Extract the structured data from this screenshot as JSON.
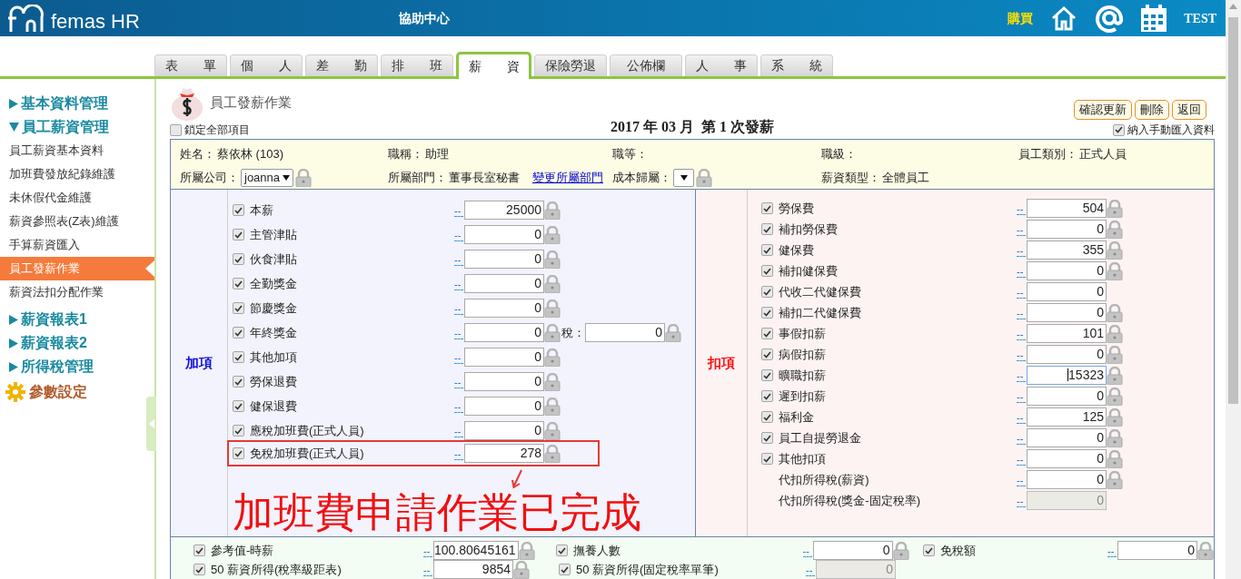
{
  "header": {
    "logo_text": "femas HR",
    "help_link": "協助中心",
    "buy_link": "購買",
    "user": "TEST"
  },
  "tabs": [
    {
      "label": "表　　單",
      "selected": false
    },
    {
      "label": "個　　人",
      "selected": false
    },
    {
      "label": "差　　勤",
      "selected": false
    },
    {
      "label": "排　　班",
      "selected": false
    },
    {
      "label": "薪　　資",
      "selected": true
    },
    {
      "label": "保險勞退",
      "selected": false
    },
    {
      "label": "公佈欄",
      "selected": false
    },
    {
      "label": "人　　事",
      "selected": false
    },
    {
      "label": "系　　統",
      "selected": false
    }
  ],
  "sidebar": {
    "items": [
      {
        "kind": "group",
        "label": "基本資料管理",
        "expanded": false
      },
      {
        "kind": "group",
        "label": "員工薪資管理",
        "expanded": true,
        "children": [
          {
            "label": "員工薪資基本資料",
            "selected": false
          },
          {
            "label": "加班費發放紀錄維護",
            "selected": false
          },
          {
            "label": "未休假代金維護",
            "selected": false
          },
          {
            "label": "薪資參照表(Z表)維護",
            "selected": false
          },
          {
            "label": "手算薪資匯入",
            "selected": false
          },
          {
            "label": "員工發薪作業",
            "selected": true
          },
          {
            "label": "薪資法扣分配作業",
            "selected": false
          }
        ]
      },
      {
        "kind": "group",
        "label": "薪資報表1",
        "expanded": false
      },
      {
        "kind": "group",
        "label": "薪資報表2",
        "expanded": false
      },
      {
        "kind": "group",
        "label": "所得稅管理",
        "expanded": false
      },
      {
        "kind": "settings",
        "label": "參數設定"
      }
    ]
  },
  "page": {
    "title": "員工發薪作業",
    "buttons": [
      "確認更新",
      "刪除",
      "返回"
    ],
    "lock_all": {
      "label": "鎖定全部項目",
      "checked": false
    },
    "heading": "2017 年 03 月  第 1 次發薪",
    "include_manual": {
      "label": "納入手動匯入資料",
      "checked": true
    }
  },
  "info": {
    "name": {
      "label": "姓名：",
      "value": "蔡依林 (103)"
    },
    "job_title": {
      "label": "職稱：",
      "value": "助理"
    },
    "grade": {
      "label": "職等："
    },
    "level": {
      "label": "職級："
    },
    "category": {
      "label": "員工類別：",
      "value": "正式人員"
    },
    "company": {
      "label": "所屬公司：",
      "value": "joanna"
    },
    "department": {
      "label": "所屬部門：",
      "value": "董事長室秘書",
      "link": "變更所屬部門"
    },
    "cost": {
      "label": "成本歸屬："
    },
    "salary_type": {
      "label": "薪資類型：",
      "value": "全體員工"
    }
  },
  "additions": {
    "title": "加項",
    "rows": [
      {
        "kind": "check",
        "checked": true,
        "label": "本薪",
        "link": "--",
        "value": "25000",
        "lock": true,
        "highlighted": false
      },
      {
        "kind": "check",
        "checked": true,
        "label": "主管津貼",
        "link": "--",
        "value": "0",
        "lock": true,
        "highlighted": false
      },
      {
        "kind": "check",
        "checked": true,
        "label": "伙食津貼",
        "link": "--",
        "value": "0",
        "lock": true,
        "highlighted": false
      },
      {
        "kind": "check",
        "checked": true,
        "label": "全勤獎金",
        "link": "--",
        "value": "0",
        "lock": true,
        "highlighted": false
      },
      {
        "kind": "check",
        "checked": true,
        "label": "節慶獎金",
        "link": "--",
        "value": "0",
        "lock": true,
        "highlighted": false
      },
      {
        "kind": "check",
        "checked": true,
        "label": "年終獎金",
        "link": "--",
        "value": "0",
        "lock": true,
        "highlighted": false,
        "tax_label": "稅：",
        "tax_value": "0"
      },
      {
        "kind": "check",
        "checked": true,
        "label": "其他加項",
        "link": "--",
        "value": "0",
        "lock": true,
        "highlighted": false
      },
      {
        "kind": "check",
        "checked": true,
        "label": "勞保退費",
        "link": "--",
        "value": "0",
        "lock": true,
        "highlighted": false
      },
      {
        "kind": "check",
        "checked": true,
        "label": "健保退費",
        "link": "--",
        "value": "0",
        "lock": true,
        "highlighted": false
      },
      {
        "kind": "check",
        "checked": true,
        "label": "應稅加班費(正式人員)",
        "link": "--",
        "value": "0",
        "lock": true,
        "highlighted": false
      },
      {
        "kind": "check",
        "checked": true,
        "label": "免稅加班費(正式人員)",
        "link": "--",
        "value": "278",
        "lock": true,
        "highlighted": true
      }
    ],
    "annotation": "加班費申請作業已完成"
  },
  "deductions": {
    "title": "扣項",
    "rows": [
      {
        "kind": "check",
        "checked": true,
        "label": "勞保費",
        "link": "--",
        "value": "504",
        "lock": true
      },
      {
        "kind": "check",
        "checked": true,
        "label": "補扣勞保費",
        "link": "--",
        "value": "0",
        "lock": true
      },
      {
        "kind": "check",
        "checked": true,
        "label": "健保費",
        "link": "--",
        "value": "355",
        "lock": true
      },
      {
        "kind": "check",
        "checked": true,
        "label": "補扣健保費",
        "link": "--",
        "value": "0",
        "lock": true
      },
      {
        "kind": "check",
        "checked": true,
        "label": "代收二代健保費",
        "link": "--",
        "value": "0",
        "lock": false
      },
      {
        "kind": "check",
        "checked": true,
        "label": "補扣二代健保費",
        "link": "--",
        "value": "0",
        "lock": true
      },
      {
        "kind": "check",
        "checked": true,
        "label": "事假扣薪",
        "link": "--",
        "value": "101",
        "lock": true
      },
      {
        "kind": "check",
        "checked": true,
        "label": "病假扣薪",
        "link": "--",
        "value": "0",
        "lock": true
      },
      {
        "kind": "check",
        "checked": true,
        "label": "曠職扣薪",
        "link": "--",
        "value": "15323",
        "lock": true,
        "focused": true
      },
      {
        "kind": "check",
        "checked": true,
        "label": "遲到扣薪",
        "link": "--",
        "value": "0",
        "lock": true
      },
      {
        "kind": "check",
        "checked": true,
        "label": "福利金",
        "link": "--",
        "value": "125",
        "lock": true
      },
      {
        "kind": "check",
        "checked": true,
        "label": "員工自提勞退金",
        "link": "--",
        "value": "0",
        "lock": true
      },
      {
        "kind": "check",
        "checked": true,
        "label": "其他扣項",
        "link": "--",
        "value": "0",
        "lock": true
      },
      {
        "kind": "plain",
        "label": "代扣所得稅(薪資)",
        "link": "--",
        "value": "0",
        "lock": true
      },
      {
        "kind": "plain",
        "label": "代扣所得稅(獎金-固定稅率)",
        "link": "--",
        "value": "0",
        "lock": false,
        "disabled": true
      }
    ]
  },
  "summary": {
    "rows": [
      [
        {
          "checked": true,
          "label": "參考值-時薪",
          "link": "--",
          "value": "100.80645161",
          "lock": true
        },
        {
          "checked": true,
          "label": "撫養人數",
          "link": "--",
          "value": "0",
          "lock": true
        },
        {
          "checked": true,
          "label": "免稅額",
          "link": "--",
          "value": "0",
          "lock": true
        }
      ],
      [
        {
          "checked": true,
          "label": "50 薪資所得(稅率級距表)",
          "link": "--",
          "value": "9854",
          "lock": true
        },
        {
          "checked": true,
          "label": "50 薪資所得(固定稅率單筆)",
          "link": "--",
          "value": "0",
          "lock": false,
          "disabled": true
        }
      ]
    ]
  }
}
